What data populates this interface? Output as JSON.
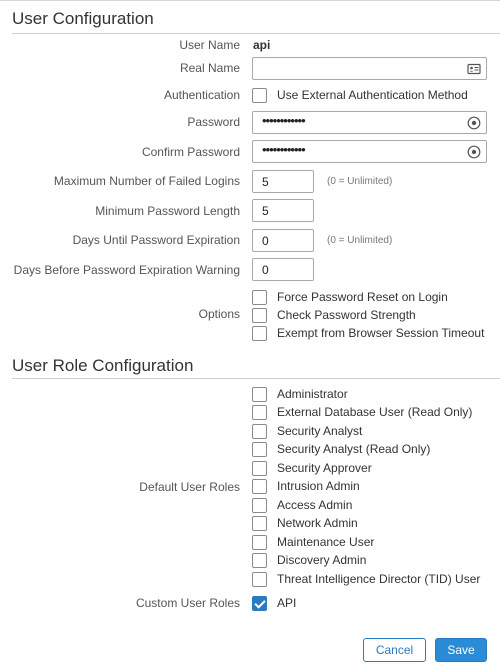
{
  "user_config": {
    "title": "User Configuration",
    "user_name_label": "User Name",
    "user_name_value": "api",
    "real_name_label": "Real Name",
    "real_name_value": "",
    "authentication_label": "Authentication",
    "external_auth_label": "Use External Authentication Method",
    "external_auth_checked": false,
    "password_label": "Password",
    "password_value": "••••••••••••",
    "confirm_password_label": "Confirm Password",
    "confirm_password_value": "••••••••••••",
    "max_failed_label": "Maximum Number of Failed Logins",
    "max_failed_value": "5",
    "max_failed_hint": "(0 = Unlimited)",
    "min_length_label": "Minimum Password Length",
    "min_length_value": "5",
    "days_expiration_label": "Days Until Password Expiration",
    "days_expiration_value": "0",
    "days_expiration_hint": "(0 = Unlimited)",
    "days_warning_label": "Days Before Password Expiration Warning",
    "days_warning_value": "0",
    "options_label": "Options",
    "options": [
      {
        "label": "Force Password Reset on Login",
        "checked": false
      },
      {
        "label": "Check Password Strength",
        "checked": false
      },
      {
        "label": "Exempt from Browser Session Timeout",
        "checked": false
      }
    ]
  },
  "role_config": {
    "title": "User Role Configuration",
    "default_roles_label": "Default User Roles",
    "default_roles": [
      {
        "label": "Administrator",
        "checked": false
      },
      {
        "label": "External Database User (Read Only)",
        "checked": false
      },
      {
        "label": "Security Analyst",
        "checked": false
      },
      {
        "label": "Security Analyst (Read Only)",
        "checked": false
      },
      {
        "label": "Security Approver",
        "checked": false
      },
      {
        "label": "Intrusion Admin",
        "checked": false
      },
      {
        "label": "Access Admin",
        "checked": false
      },
      {
        "label": "Network Admin",
        "checked": false
      },
      {
        "label": "Maintenance User",
        "checked": false
      },
      {
        "label": "Discovery Admin",
        "checked": false
      },
      {
        "label": "Threat Intelligence Director (TID) User",
        "checked": false
      }
    ],
    "custom_roles_label": "Custom User Roles",
    "custom_roles": [
      {
        "label": "API",
        "checked": true
      }
    ]
  },
  "footer": {
    "cancel_label": "Cancel",
    "save_label": "Save"
  },
  "colors": {
    "accent": "#2a7bbf",
    "save_bg": "#2a8cd6"
  },
  "icons": {
    "real_name_icon": "contact-card-icon",
    "password_icon": "password-reveal-icon"
  }
}
